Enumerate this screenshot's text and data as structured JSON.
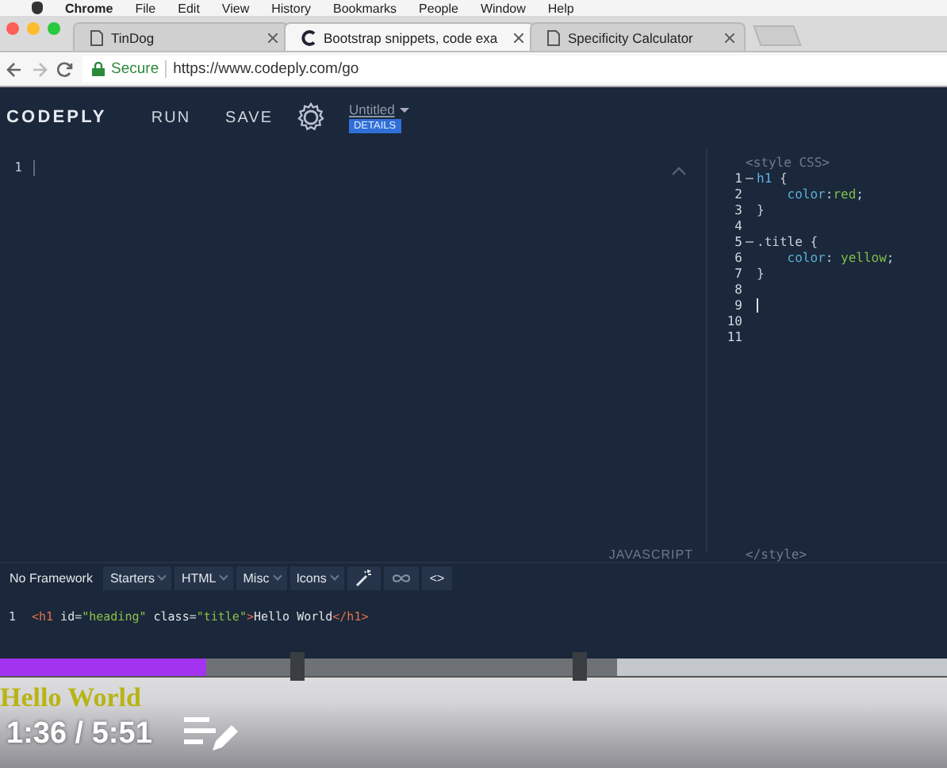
{
  "menu_bar": {
    "items": [
      "Chrome",
      "File",
      "Edit",
      "View",
      "History",
      "Bookmarks",
      "People",
      "Window",
      "Help"
    ]
  },
  "tabs": [
    {
      "label": "TinDog",
      "selected": false
    },
    {
      "label": "Bootstrap snippets, code exa",
      "selected": true
    },
    {
      "label": "Specificity Calculator",
      "selected": false
    }
  ],
  "address_bar": {
    "security": "Secure",
    "url": "https://www.codeply.com/go"
  },
  "app": {
    "logo": "CODEPLY",
    "actions": [
      "RUN",
      "SAVE"
    ],
    "project": {
      "title": "Untitled",
      "badge": "DETAILS"
    }
  },
  "html_editor": {
    "line_numbers": [
      "1"
    ]
  },
  "css_editor": {
    "header": "<style CSS>",
    "footer": "</style>",
    "lines": [
      {
        "number": "1",
        "foldable": true,
        "cursor": false,
        "tokens": [
          {
            "t": "h1",
            "kind": "selector"
          },
          {
            "t": " {",
            "kind": "punct"
          }
        ]
      },
      {
        "number": "2",
        "foldable": false,
        "cursor": false,
        "tokens": [
          {
            "t": "    color",
            "kind": "property"
          },
          {
            "t": ":",
            "kind": "punct"
          },
          {
            "t": "red",
            "kind": "value"
          },
          {
            "t": ";",
            "kind": "punct"
          }
        ]
      },
      {
        "number": "3",
        "foldable": false,
        "cursor": false,
        "tokens": [
          {
            "t": "}",
            "kind": "punct"
          }
        ]
      },
      {
        "number": "4",
        "foldable": false,
        "cursor": false
      },
      {
        "number": "5",
        "foldable": true,
        "cursor": false,
        "tokens": [
          {
            "t": ".title {",
            "kind": "punct"
          }
        ]
      },
      {
        "number": "6",
        "foldable": false,
        "cursor": false,
        "tokens": [
          {
            "t": "    color",
            "kind": "property"
          },
          {
            "t": ": ",
            "kind": "punct"
          },
          {
            "t": "yellow",
            "kind": "value"
          },
          {
            "t": ";",
            "kind": "punct"
          }
        ]
      },
      {
        "number": "7",
        "foldable": false,
        "cursor": false,
        "tokens": [
          {
            "t": "}",
            "kind": "punct"
          }
        ]
      },
      {
        "number": "8",
        "foldable": false,
        "cursor": false
      },
      {
        "number": "9",
        "foldable": false,
        "cursor": true
      },
      {
        "number": "10",
        "foldable": false,
        "cursor": false
      },
      {
        "number": "11",
        "foldable": false,
        "cursor": false
      }
    ]
  },
  "javascript_label": "JAVASCRIPT",
  "toolbar": [
    {
      "label": "No Framework",
      "kind": "text"
    },
    {
      "label": "Starters",
      "kind": "dropdown"
    },
    {
      "label": "HTML",
      "kind": "dropdown"
    },
    {
      "label": "Misc",
      "kind": "dropdown"
    },
    {
      "label": "Icons",
      "kind": "dropdown"
    },
    {
      "kind": "wand"
    },
    {
      "kind": "link"
    },
    {
      "label": "<>",
      "kind": "code"
    }
  ],
  "body_editor": {
    "lines": [
      {
        "number": "1",
        "tokens": [
          {
            "t": "<h1",
            "kind": "tag"
          },
          {
            "t": " id",
            "kind": "attr"
          },
          {
            "t": "=",
            "kind": "punct"
          },
          {
            "t": "\"heading\"",
            "kind": "string"
          },
          {
            "t": " class",
            "kind": "attr"
          },
          {
            "t": "=",
            "kind": "punct"
          },
          {
            "t": "\"title\"",
            "kind": "string"
          },
          {
            "t": ">",
            "kind": "tag"
          },
          {
            "t": "Hello World",
            "kind": "text"
          },
          {
            "t": "</h1>",
            "kind": "tag"
          }
        ]
      }
    ]
  },
  "video_player": {
    "preview_text": "Hello World",
    "progress": {
      "level": 0.218
    },
    "buffered": {
      "level": 0.652
    },
    "time": "1:36 / 5:51"
  }
}
